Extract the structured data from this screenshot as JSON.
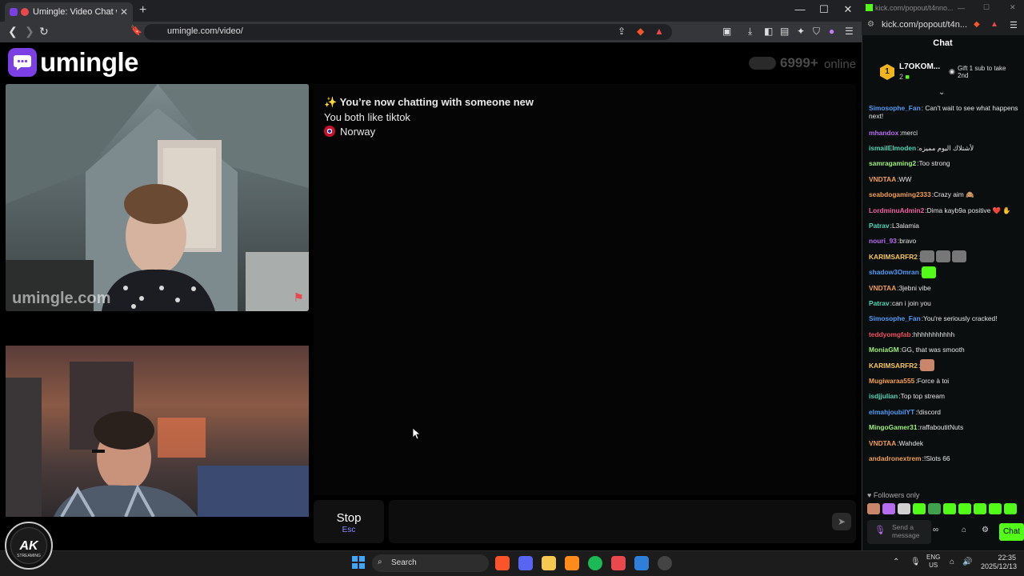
{
  "browser": {
    "tab_title": "Umingle: Video Chat with Stra",
    "url": "umingle.com/video/",
    "new_tab": "+",
    "tab_close": "✕",
    "win_minimize": "—",
    "win_maximize": "☐",
    "win_close": "✕"
  },
  "site": {
    "logo_text": "umingle",
    "online_count": "6999+",
    "online_label": "online",
    "watermark": "umingle.com"
  },
  "chat": {
    "system_message": "You’re now chatting with someone new",
    "common_interest": "You both like tiktok",
    "country": "Norway",
    "stop_label": "Stop",
    "stop_shortcut": "Esc"
  },
  "kick": {
    "window_title": "kick.com/popout/t4nno...",
    "url": "kick.com/popout/t4n...",
    "header": "Chat",
    "pinned_user": "L7OKOM...",
    "pinned_rank": "1",
    "pinned_count": "2",
    "gift_text": "Gift 1 sub to take 2nd",
    "messages": [
      {
        "user": "Simosophe_Fan",
        "text": "Can't wait to see what happens next!",
        "color": "#4f9cf7",
        "wrap": true
      },
      {
        "user": "mhandox",
        "text": "merci",
        "color": "#b66cf0"
      },
      {
        "user": "ismailElmoden",
        "text": "لأشتلاك اليوم مميزه",
        "color": "#4fd6b8"
      },
      {
        "user": "samragaming2",
        "text": "Too strong",
        "color": "#9ef07a"
      },
      {
        "user": "VNDTAA",
        "text": "WW",
        "color": "#f0a04f"
      },
      {
        "user": "seabdogaming2333",
        "text": "Crazy aim 🙈",
        "color": "#f0a04f"
      },
      {
        "user": "LordminuAdmin2",
        "text": "Dima kayb9a positive ❤️ ✋",
        "color": "#f05fa0"
      },
      {
        "user": "Patrav",
        "text": "L3alamia",
        "color": "#4fd6b8"
      },
      {
        "user": "nouri_93",
        "text": "bravo",
        "color": "#b66cf0"
      },
      {
        "user": "KARIMSARFR2",
        "text": "",
        "color": "#f5c84f",
        "emotes": [
          "#777",
          "#777",
          "#777"
        ]
      },
      {
        "user": "shadow3Omran",
        "text": "",
        "color": "#4f9cf7",
        "emotes": [
          "#53fc18"
        ]
      },
      {
        "user": "VNDTAA",
        "text": "3jebni vibe",
        "color": "#f0a04f"
      },
      {
        "user": "Patrav",
        "text": "can i join you",
        "color": "#4fd6b8"
      },
      {
        "user": "Simosophe_Fan",
        "text": "You're seriously cracked!",
        "color": "#4f9cf7"
      },
      {
        "user": "teddyomgfab",
        "text": "hhhhhhhhhhh",
        "color": "#f04f5f"
      },
      {
        "user": "MoniaGM",
        "text": "GG, that was smooth",
        "color": "#9ef07a"
      },
      {
        "user": "KARIMSARFR2",
        "text": "",
        "color": "#f5c84f",
        "emotes": [
          "#c9866a"
        ]
      },
      {
        "user": "Mugiwaraa555",
        "text": "Force à toi",
        "color": "#f0a04f"
      },
      {
        "user": "isdjjulian",
        "text": "Top top stream",
        "color": "#4fd6b8"
      },
      {
        "user": "elmahjoubiIYT",
        "text": "!discord",
        "color": "#4f9cf7"
      },
      {
        "user": "MingoGamer31",
        "text": "raffaboutitNuts",
        "color": "#9ef07a"
      },
      {
        "user": "VNDTAA",
        "text": "Wahdek",
        "color": "#f0a04f"
      },
      {
        "user": "andadronextrem",
        "text": "!Slots 66",
        "color": "#f0a04f"
      }
    ],
    "followers_only": "Followers only",
    "send_placeholder": "Send a message",
    "chat_button": "Chat"
  },
  "taskbar": {
    "search_label": "Search",
    "lang": "ENG",
    "region": "US",
    "time": "22:35",
    "date": "2025/12/13"
  },
  "overlay": {
    "logo_text": "AK",
    "logo_sub": "STREAMING"
  }
}
